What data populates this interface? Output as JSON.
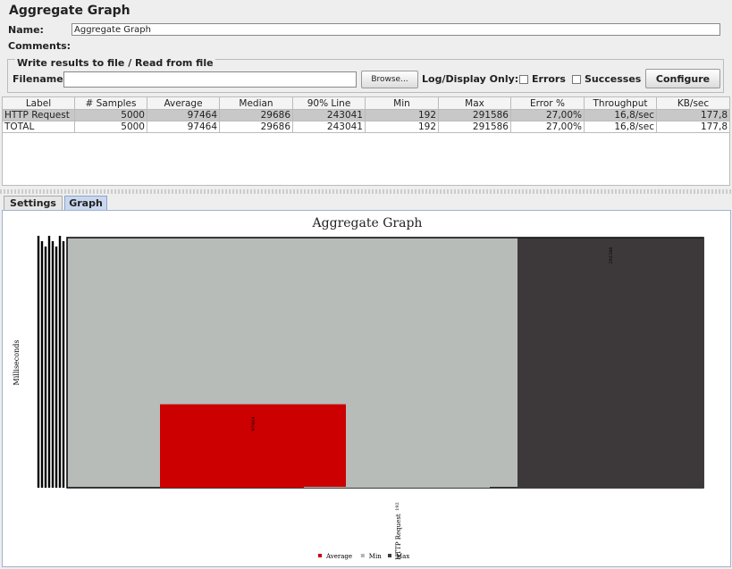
{
  "window": {
    "title": "Aggregate Graph"
  },
  "form": {
    "name_label": "Name:",
    "name_value": "Aggregate Graph",
    "comments_label": "Comments:",
    "file_section_label": "Write results to file / Read from file",
    "filename_label": "Filename",
    "filename_value": "",
    "browse_label": "Browse...",
    "log_display_label": "Log/Display Only:",
    "errors_label": "Errors",
    "successes_label": "Successes",
    "configure_label": "Configure"
  },
  "table": {
    "columns": [
      "Label",
      "# Samples",
      "Average",
      "Median",
      "90% Line",
      "Min",
      "Max",
      "Error %",
      "Throughput",
      "KB/sec"
    ],
    "rows": [
      [
        "HTTP Request",
        "5000",
        "97464",
        "29686",
        "243041",
        "192",
        "291586",
        "27,00%",
        "16,8/sec",
        "177,8"
      ],
      [
        "TOTAL",
        "5000",
        "97464",
        "29686",
        "243041",
        "192",
        "291586",
        "27,00%",
        "16,8/sec",
        "177,8"
      ]
    ]
  },
  "tabs": [
    {
      "label": "Settings",
      "active": false
    },
    {
      "label": "Graph",
      "active": true
    }
  ],
  "chart_data": {
    "type": "bar",
    "title": "Aggregate Graph",
    "ylabel": "Milliseconds",
    "xlabel": "",
    "categories": [
      "HTTP Request"
    ],
    "series": [
      {
        "name": "Average",
        "values": [
          97464
        ],
        "color": "#cc0000"
      },
      {
        "name": "Min",
        "values": [
          192
        ],
        "color": "#b0b5b2"
      },
      {
        "name": "Max",
        "values": [
          291586
        ],
        "color": "#3d393a"
      }
    ],
    "ylim": [
      0,
      291586
    ],
    "value_labels": [
      "97464",
      "192",
      "291586"
    ],
    "legend_position": "bottom",
    "background_color": "#b7bcb9"
  }
}
